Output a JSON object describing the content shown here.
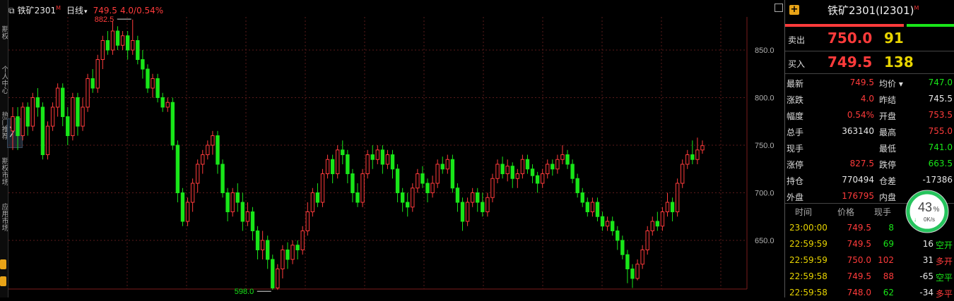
{
  "left_strip": {
    "labels": [
      "期权",
      "个人中心",
      "热门推荐",
      "期权市场",
      "应用市场"
    ],
    "expand_glyph": "〉"
  },
  "chart": {
    "header": {
      "window_icon": "window-icon",
      "symbol": "铁矿2301",
      "symbol_badge": "M",
      "period": "日线",
      "period_arrow": "▾",
      "last_price": "749.5",
      "change": "4.0/0.54%"
    },
    "annotations": {
      "high_label": "882.5",
      "low_label": "598.0"
    },
    "axis_labels": [
      "850.0",
      "800.0",
      "750.0",
      "700.0",
      "650.0"
    ]
  },
  "chart_data": {
    "type": "candlestick",
    "title": "铁矿2301",
    "xlabel": "",
    "ylabel": "",
    "ylim": [
      592,
      880
    ],
    "yticks": [
      650,
      700,
      750,
      800,
      850
    ],
    "grid": true,
    "high": 882.5,
    "low": 598.0,
    "candles": [
      [
        765,
        780,
        790,
        745
      ],
      [
        780,
        760,
        790,
        745
      ],
      [
        760,
        790,
        795,
        755
      ],
      [
        790,
        770,
        795,
        760
      ],
      [
        770,
        800,
        805,
        765
      ],
      [
        800,
        790,
        810,
        780
      ],
      [
        790,
        740,
        795,
        735
      ],
      [
        740,
        770,
        775,
        735
      ],
      [
        770,
        790,
        795,
        765
      ],
      [
        790,
        810,
        815,
        780
      ],
      [
        810,
        780,
        815,
        770
      ],
      [
        780,
        760,
        790,
        750
      ],
      [
        760,
        800,
        805,
        755
      ],
      [
        800,
        770,
        805,
        760
      ],
      [
        770,
        790,
        800,
        765
      ],
      [
        790,
        820,
        825,
        785
      ],
      [
        820,
        810,
        830,
        805
      ],
      [
        810,
        840,
        845,
        805
      ],
      [
        840,
        860,
        865,
        830
      ],
      [
        860,
        850,
        870,
        845
      ],
      [
        850,
        870,
        880,
        845
      ],
      [
        870,
        855,
        875,
        850
      ],
      [
        855,
        865,
        870,
        850
      ],
      [
        865,
        850,
        870,
        840
      ],
      [
        850,
        860,
        882,
        845
      ],
      [
        860,
        840,
        865,
        835
      ],
      [
        840,
        830,
        850,
        820
      ],
      [
        830,
        810,
        835,
        805
      ],
      [
        810,
        820,
        825,
        800
      ],
      [
        820,
        800,
        825,
        795
      ],
      [
        800,
        790,
        805,
        785
      ],
      [
        790,
        795,
        800,
        785
      ],
      [
        795,
        750,
        800,
        745
      ],
      [
        750,
        700,
        755,
        690
      ],
      [
        700,
        670,
        705,
        665
      ],
      [
        670,
        690,
        695,
        665
      ],
      [
        690,
        710,
        715,
        680
      ],
      [
        710,
        730,
        735,
        700
      ],
      [
        730,
        740,
        745,
        720
      ],
      [
        740,
        750,
        755,
        735
      ],
      [
        750,
        760,
        765,
        740
      ],
      [
        760,
        730,
        765,
        720
      ],
      [
        730,
        700,
        735,
        695
      ],
      [
        700,
        680,
        705,
        670
      ],
      [
        680,
        700,
        705,
        675
      ],
      [
        700,
        690,
        710,
        680
      ],
      [
        690,
        670,
        700,
        660
      ],
      [
        670,
        680,
        690,
        665
      ],
      [
        680,
        660,
        685,
        650
      ],
      [
        660,
        640,
        665,
        630
      ],
      [
        640,
        650,
        660,
        630
      ],
      [
        650,
        630,
        655,
        620
      ],
      [
        630,
        600,
        635,
        598
      ],
      [
        600,
        620,
        625,
        598
      ],
      [
        620,
        640,
        645,
        610
      ],
      [
        640,
        630,
        648,
        620
      ],
      [
        630,
        645,
        650,
        625
      ],
      [
        645,
        640,
        650,
        630
      ],
      [
        640,
        660,
        665,
        635
      ],
      [
        660,
        680,
        690,
        655
      ],
      [
        680,
        700,
        705,
        675
      ],
      [
        700,
        690,
        710,
        685
      ],
      [
        690,
        720,
        725,
        685
      ],
      [
        720,
        735,
        740,
        715
      ],
      [
        735,
        720,
        740,
        710
      ],
      [
        720,
        745,
        750,
        715
      ],
      [
        745,
        740,
        755,
        730
      ],
      [
        740,
        720,
        745,
        710
      ],
      [
        720,
        700,
        725,
        690
      ],
      [
        700,
        690,
        710,
        685
      ],
      [
        690,
        720,
        725,
        685
      ],
      [
        720,
        740,
        745,
        715
      ],
      [
        740,
        735,
        750,
        725
      ],
      [
        735,
        745,
        750,
        730
      ],
      [
        745,
        730,
        750,
        720
      ],
      [
        730,
        740,
        745,
        725
      ],
      [
        740,
        725,
        745,
        715
      ],
      [
        725,
        700,
        730,
        690
      ],
      [
        700,
        690,
        705,
        680
      ],
      [
        690,
        685,
        700,
        675
      ],
      [
        685,
        705,
        710,
        680
      ],
      [
        705,
        720,
        725,
        700
      ],
      [
        720,
        710,
        728,
        705
      ],
      [
        710,
        700,
        715,
        690
      ],
      [
        700,
        710,
        718,
        695
      ],
      [
        710,
        730,
        735,
        705
      ],
      [
        730,
        725,
        738,
        720
      ],
      [
        725,
        735,
        740,
        720
      ],
      [
        735,
        705,
        740,
        700
      ],
      [
        705,
        690,
        710,
        680
      ],
      [
        690,
        670,
        695,
        660
      ],
      [
        670,
        690,
        695,
        665
      ],
      [
        690,
        700,
        705,
        685
      ],
      [
        700,
        690,
        705,
        680
      ],
      [
        690,
        680,
        700,
        675
      ],
      [
        680,
        695,
        700,
        675
      ],
      [
        695,
        715,
        720,
        690
      ],
      [
        715,
        730,
        735,
        710
      ],
      [
        730,
        720,
        738,
        715
      ],
      [
        720,
        728,
        735,
        712
      ],
      [
        728,
        715,
        732,
        705
      ],
      [
        715,
        720,
        725,
        705
      ],
      [
        720,
        735,
        740,
        715
      ],
      [
        735,
        725,
        740,
        720
      ],
      [
        725,
        718,
        730,
        710
      ],
      [
        718,
        710,
        722,
        700
      ],
      [
        710,
        720,
        725,
        705
      ],
      [
        720,
        730,
        735,
        715
      ],
      [
        730,
        725,
        735,
        718
      ],
      [
        725,
        735,
        740,
        720
      ],
      [
        735,
        740,
        750,
        730
      ],
      [
        740,
        730,
        745,
        725
      ],
      [
        730,
        715,
        735,
        710
      ],
      [
        715,
        700,
        720,
        695
      ],
      [
        700,
        690,
        705,
        685
      ],
      [
        690,
        680,
        695,
        675
      ],
      [
        680,
        690,
        695,
        675
      ],
      [
        690,
        675,
        695,
        670
      ],
      [
        675,
        665,
        680,
        660
      ],
      [
        665,
        670,
        675,
        660
      ],
      [
        670,
        660,
        675,
        655
      ],
      [
        660,
        650,
        665,
        640
      ],
      [
        650,
        635,
        655,
        630
      ],
      [
        635,
        620,
        640,
        605
      ],
      [
        620,
        610,
        625,
        600
      ],
      [
        610,
        625,
        630,
        608
      ],
      [
        625,
        640,
        645,
        620
      ],
      [
        640,
        660,
        665,
        635
      ],
      [
        660,
        670,
        675,
        655
      ],
      [
        670,
        665,
        680,
        660
      ],
      [
        665,
        680,
        685,
        660
      ],
      [
        680,
        690,
        700,
        675
      ],
      [
        690,
        680,
        695,
        670
      ],
      [
        680,
        710,
        715,
        675
      ],
      [
        710,
        730,
        735,
        705
      ],
      [
        730,
        740,
        745,
        725
      ],
      [
        740,
        735,
        755,
        730
      ],
      [
        735,
        745,
        758,
        730
      ],
      [
        745,
        749.5,
        755,
        741
      ]
    ]
  },
  "right_panel": {
    "plus_glyph": "+",
    "title": "铁矿2301(I2301)",
    "title_badge": "M",
    "ask_label": "卖出",
    "ask_price": "750.0",
    "ask_vol": "91",
    "bid_label": "买入",
    "bid_price": "749.5",
    "bid_vol": "138",
    "quote_rows": [
      {
        "l1": "最新",
        "v1": "749.5",
        "c1": "red",
        "l2": "均价 ▾",
        "v2": "747.0",
        "c2": "green"
      },
      {
        "l1": "涨跌",
        "v1": "4.0",
        "c1": "red",
        "l2": "昨结",
        "v2": "745.5",
        "c2": "white"
      },
      {
        "l1": "幅度",
        "v1": "0.54%",
        "c1": "red",
        "l2": "开盘",
        "v2": "753.5",
        "c2": "red"
      },
      {
        "l1": "总手",
        "v1": "363140",
        "c1": "white",
        "l2": "最高",
        "v2": "755.0",
        "c2": "red"
      },
      {
        "l1": "现手",
        "v1": "",
        "c1": "white",
        "l2": "最低",
        "v2": "741.0",
        "c2": "green"
      },
      {
        "l1": "涨停",
        "v1": "827.5",
        "c1": "red",
        "l2": "跌停",
        "v2": "663.5",
        "c2": "green"
      },
      {
        "l1": "持仓",
        "v1": "770494",
        "c1": "white",
        "l2": "仓差",
        "v2": "-17386",
        "c2": "white"
      },
      {
        "l1": "外盘",
        "v1": "176795",
        "c1": "red",
        "l2": "内盘",
        "v2": "",
        "c2": "green"
      }
    ],
    "tick_headers": [
      "时间",
      "价格",
      "现手"
    ],
    "ticks": [
      {
        "time": "23:00:00",
        "price": "749.5",
        "pc": "red",
        "vol": "8",
        "vc": "green",
        "chg": "",
        "type": "",
        "tc": "green"
      },
      {
        "time": "22:59:59",
        "price": "749.5",
        "pc": "red",
        "vol": "69",
        "vc": "green",
        "chg": "16",
        "type": "空开",
        "tc": "green"
      },
      {
        "time": "22:59:59",
        "price": "750.0",
        "pc": "red",
        "vol": "102",
        "vc": "red",
        "chg": "31",
        "type": "多开",
        "tc": "red"
      },
      {
        "time": "22:59:58",
        "price": "749.5",
        "pc": "red",
        "vol": "88",
        "vc": "red",
        "chg": "-65",
        "type": "空平",
        "tc": "green"
      },
      {
        "time": "22:59:58",
        "price": "748.0",
        "pc": "red",
        "vol": "62",
        "vc": "green",
        "chg": "-34",
        "type": "多平",
        "tc": "red"
      }
    ]
  },
  "speed_badge": {
    "percent": "43",
    "percent_sign": "%",
    "rate": "0K/s",
    "level": 0.43
  },
  "colors": {
    "up": "#ff3b3b",
    "down": "#19e619",
    "grid": "#5a1a1a",
    "accent": "#e8a317"
  }
}
